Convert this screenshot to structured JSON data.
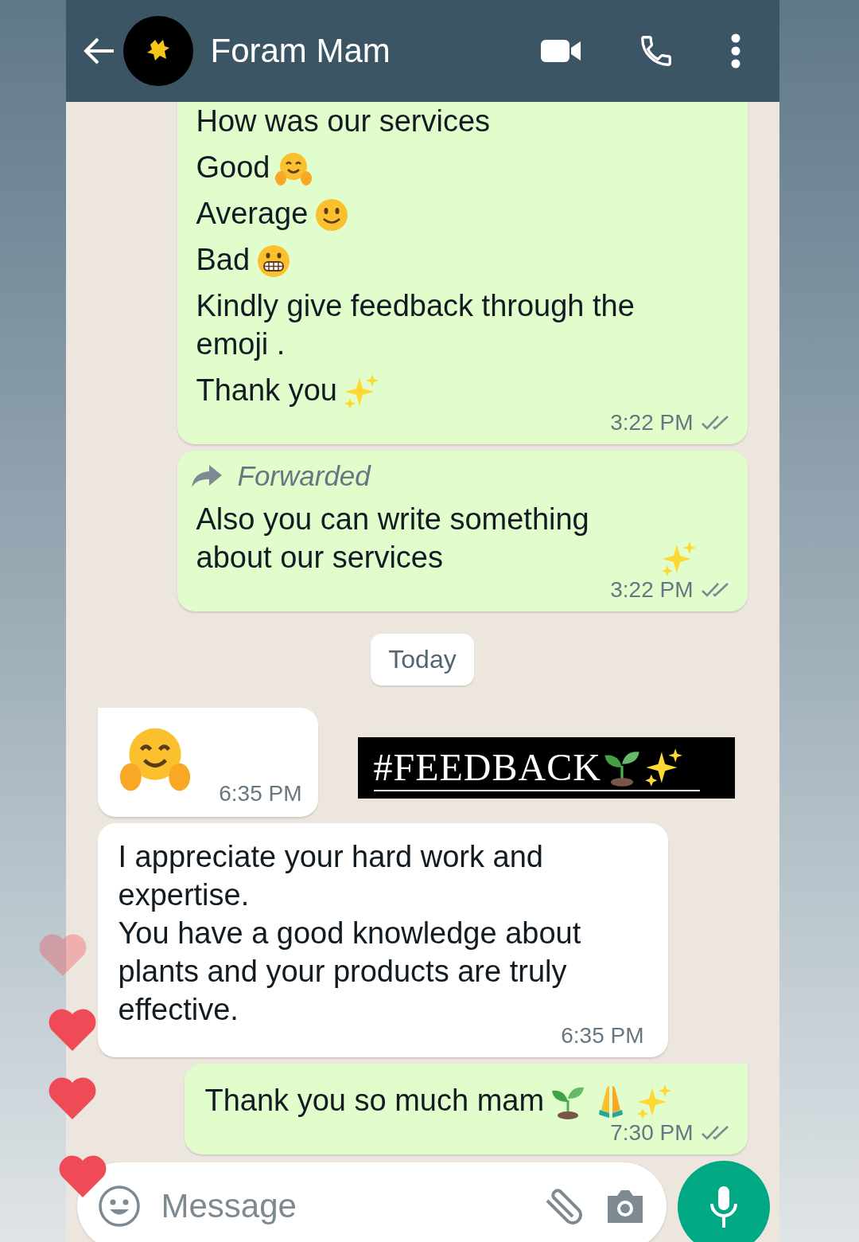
{
  "header": {
    "title": "Foram Mam"
  },
  "messages": [
    {
      "kind": "text",
      "outgoing": true,
      "forwarded": false,
      "lines": [
        {
          "text": "How was our services"
        },
        {
          "text": "Good",
          "emoji": [
            {
              "kind": "hug"
            }
          ]
        },
        {
          "text": "Average",
          "emoji": [
            {
              "kind": "smile"
            }
          ]
        },
        {
          "text": "Bad",
          "emoji": [
            {
              "kind": "grimace"
            }
          ]
        },
        {
          "text": "Kindly give feedback through the emoji ."
        },
        {
          "text": "Thank you",
          "emoji": [
            {
              "kind": "sparkles"
            }
          ]
        }
      ],
      "time": "3:22 PM",
      "delivered": true
    },
    {
      "kind": "text",
      "outgoing": true,
      "forwarded": true,
      "forwarded_label": "Forwarded",
      "lines": [
        {
          "text": "Also you can write something about our services",
          "emoji": [
            {
              "kind": "sparkles"
            }
          ]
        }
      ],
      "time": "3:22 PM",
      "delivered": true
    },
    {
      "kind": "date",
      "text": "Today"
    },
    {
      "kind": "emoji",
      "outgoing": false,
      "emoji": [
        {
          "kind": "hug"
        }
      ],
      "time": "6:35 PM",
      "sticker": {
        "text": "#FEEDBACK",
        "emoji": [
          {
            "kind": "seedling"
          },
          {
            "kind": "sparkles"
          }
        ]
      }
    },
    {
      "kind": "text",
      "outgoing": false,
      "forwarded": false,
      "lines": [
        {
          "text": "I appreciate your hard work and expertise.\nYou have a good knowledge about plants and your products are truly effective."
        }
      ],
      "time": "6:35 PM"
    },
    {
      "kind": "text",
      "outgoing": true,
      "forwarded": false,
      "lines": [
        {
          "text": "Thank you so much mam",
          "emoji": [
            {
              "kind": "seedling"
            },
            {
              "kind": "pray"
            },
            {
              "kind": "sparkles"
            }
          ]
        }
      ],
      "time": "7:30 PM",
      "delivered": true
    }
  ],
  "composer": {
    "placeholder": "Message"
  }
}
